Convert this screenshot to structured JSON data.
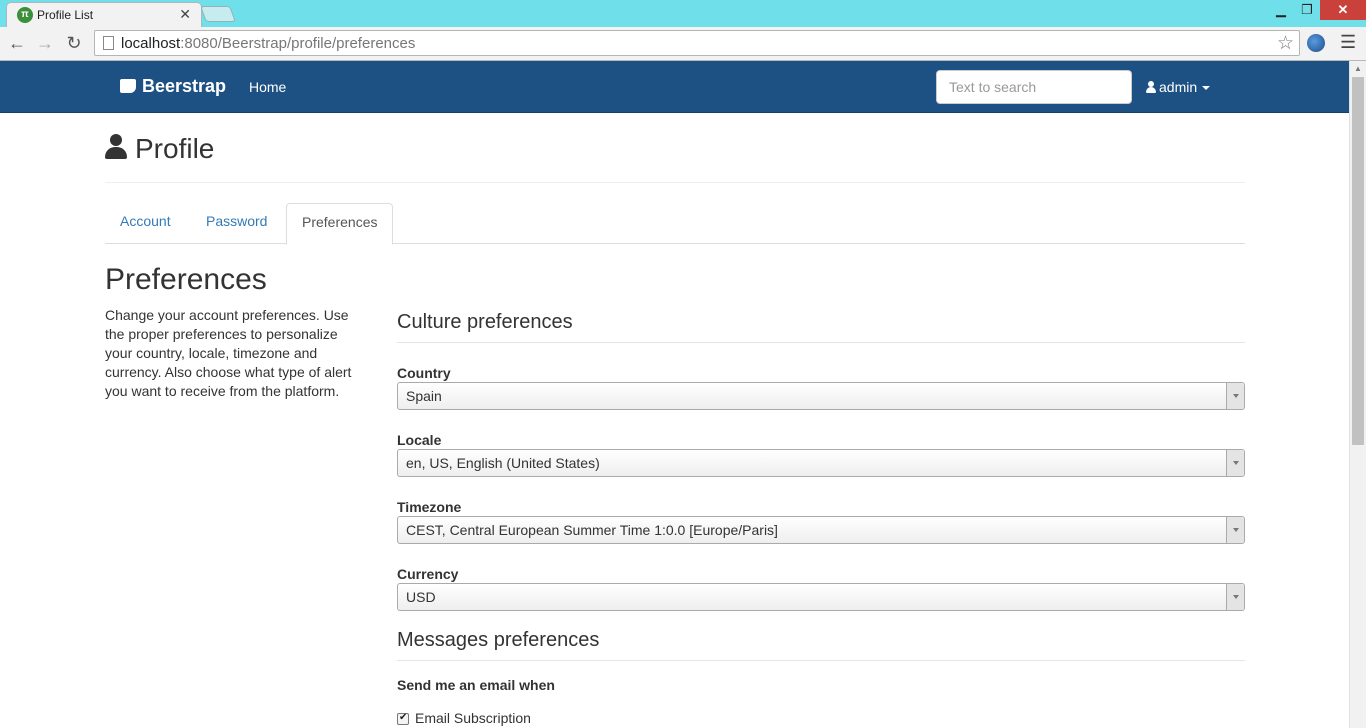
{
  "browser": {
    "tab_title": "Profile List",
    "url_host": "localhost",
    "url_rest": ":8080/Beerstrap/profile/preferences"
  },
  "navbar": {
    "brand": "Beerstrap",
    "home": "Home",
    "search_placeholder": "Text to search",
    "user": "admin"
  },
  "page": {
    "title": "Profile",
    "tabs": [
      {
        "label": "Account"
      },
      {
        "label": "Password"
      },
      {
        "label": "Preferences"
      }
    ],
    "active_tab": "Preferences",
    "section_title": "Preferences",
    "description": "Change your account preferences. Use the proper preferences to personalize your country, locale, timezone and currency. Also choose what type of alert you want to receive from the platform."
  },
  "culture": {
    "legend": "Culture preferences",
    "fields": [
      {
        "label": "Country",
        "value": "Spain"
      },
      {
        "label": "Locale",
        "value": "en, US, English (United States)"
      },
      {
        "label": "Timezone",
        "value": "CEST, Central European Summer Time 1:0.0 [Europe/Paris]"
      },
      {
        "label": "Currency",
        "value": "USD"
      }
    ]
  },
  "messages": {
    "legend": "Messages preferences",
    "send_label": "Send me an email when",
    "options": [
      {
        "label": "Email Subscription",
        "checked": true
      }
    ]
  }
}
